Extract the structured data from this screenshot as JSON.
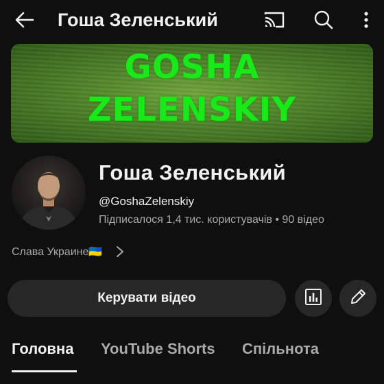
{
  "header": {
    "title": "Гоша Зеленський",
    "icons": [
      "back-arrow-icon",
      "cast-icon",
      "search-icon",
      "more-vert-icon"
    ]
  },
  "banner": {
    "line1": "GOSHA",
    "line2": "ZELENSKIY"
  },
  "channel": {
    "name": "Гоша Зеленський",
    "handle": "@GoshaZelenskiy",
    "stats": "Підписалося 1,4 тис. користувачів • 90 відео",
    "description": "Слава Украине🇺🇦"
  },
  "actions": {
    "manage_label": "Керувати відео",
    "stats_icon": "analytics-icon",
    "edit_icon": "pencil-icon"
  },
  "tabs": [
    {
      "label": "Головна",
      "active": true
    },
    {
      "label": "YouTube Shorts",
      "active": false
    },
    {
      "label": "Спільнота",
      "active": false
    }
  ],
  "colors": {
    "background": "#0f0f0f",
    "button": "#272727",
    "banner_text": "#19e819",
    "secondary_text": "#aaaaaa"
  }
}
